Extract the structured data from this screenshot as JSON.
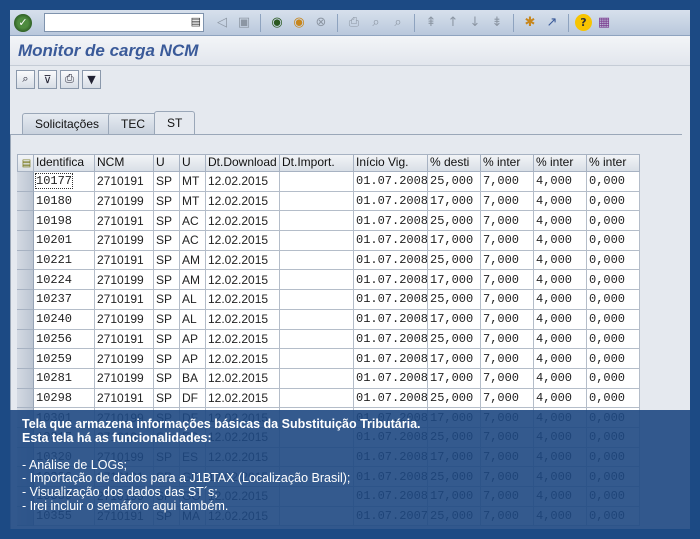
{
  "window": {
    "title": "Monitor de carga NCM"
  },
  "toolbar": {
    "command_value": ""
  },
  "tabs": [
    {
      "label": "Solicitações",
      "active": false
    },
    {
      "label": "TEC",
      "active": false
    },
    {
      "label": "ST",
      "active": true
    }
  ],
  "table": {
    "columns": [
      "Identifica",
      "NCM",
      "U",
      "U",
      "Dt.Download",
      "Dt.Import.",
      "Início Vig.",
      "% desti",
      "% inter",
      "% inter",
      "% inter"
    ],
    "rows": [
      [
        "10177",
        "2710191",
        "SP",
        "MT",
        "12.02.2015",
        "",
        "01.07.2008",
        "25,000",
        "7,000",
        "4,000",
        "0,000"
      ],
      [
        "10180",
        "2710199",
        "SP",
        "MT",
        "12.02.2015",
        "",
        "01.07.2008",
        "17,000",
        "7,000",
        "4,000",
        "0,000"
      ],
      [
        "10198",
        "2710191",
        "SP",
        "AC",
        "12.02.2015",
        "",
        "01.07.2008",
        "25,000",
        "7,000",
        "4,000",
        "0,000"
      ],
      [
        "10201",
        "2710199",
        "SP",
        "AC",
        "12.02.2015",
        "",
        "01.07.2008",
        "17,000",
        "7,000",
        "4,000",
        "0,000"
      ],
      [
        "10221",
        "2710191",
        "SP",
        "AM",
        "12.02.2015",
        "",
        "01.07.2008",
        "25,000",
        "7,000",
        "4,000",
        "0,000"
      ],
      [
        "10224",
        "2710199",
        "SP",
        "AM",
        "12.02.2015",
        "",
        "01.07.2008",
        "17,000",
        "7,000",
        "4,000",
        "0,000"
      ],
      [
        "10237",
        "2710191",
        "SP",
        "AL",
        "12.02.2015",
        "",
        "01.07.2008",
        "25,000",
        "7,000",
        "4,000",
        "0,000"
      ],
      [
        "10240",
        "2710199",
        "SP",
        "AL",
        "12.02.2015",
        "",
        "01.07.2008",
        "17,000",
        "7,000",
        "4,000",
        "0,000"
      ],
      [
        "10256",
        "2710191",
        "SP",
        "AP",
        "12.02.2015",
        "",
        "01.07.2008",
        "25,000",
        "7,000",
        "4,000",
        "0,000"
      ],
      [
        "10259",
        "2710199",
        "SP",
        "AP",
        "12.02.2015",
        "",
        "01.07.2008",
        "17,000",
        "7,000",
        "4,000",
        "0,000"
      ],
      [
        "10281",
        "2710199",
        "SP",
        "BA",
        "12.02.2015",
        "",
        "01.07.2008",
        "17,000",
        "7,000",
        "4,000",
        "0,000"
      ],
      [
        "10298",
        "2710191",
        "SP",
        "DF",
        "12.02.2015",
        "",
        "01.07.2008",
        "25,000",
        "7,000",
        "4,000",
        "0,000"
      ],
      [
        "10301",
        "2710199",
        "SP",
        "DF",
        "12.02.2015",
        "",
        "01.07.2008",
        "17,000",
        "7,000",
        "4,000",
        "0,000"
      ],
      [
        "10317",
        "2710191",
        "SP",
        "ES",
        "12.02.2015",
        "",
        "01.07.2008",
        "25,000",
        "7,000",
        "4,000",
        "0,000"
      ],
      [
        "10320",
        "2710199",
        "SP",
        "ES",
        "12.02.2015",
        "",
        "01.07.2008",
        "17,000",
        "7,000",
        "4,000",
        "0,000"
      ],
      [
        "10336",
        "2710191",
        "SP",
        "GO",
        "12.02.2015",
        "",
        "01.07.2008",
        "25,000",
        "7,000",
        "4,000",
        "0,000"
      ],
      [
        "10339",
        "2710199",
        "SP",
        "GO",
        "12.02.2015",
        "",
        "01.07.2008",
        "17,000",
        "7,000",
        "4,000",
        "0,000"
      ],
      [
        "10355",
        "2710191",
        "SP",
        "MA",
        "12.02.2015",
        "",
        "01.07.2007",
        "25,000",
        "7,000",
        "4,000",
        "0,000"
      ]
    ]
  },
  "caption": {
    "heading_1": "Tela que armazena informações básicas da Substituição Tributária.",
    "heading_2": "Esta tela há as funcionalidades:",
    "items": [
      "- Análise de LOGs;",
      "- Importação de dados para a J1BTAX (Localização Brasil);",
      "- Visualização dos dados das ST´s;",
      "- Irei incluir o semáforo aqui também."
    ]
  }
}
